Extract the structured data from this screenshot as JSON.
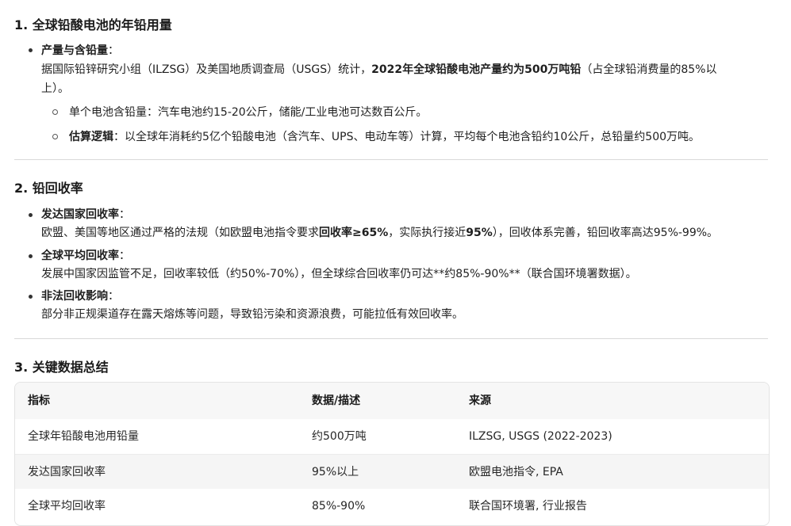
{
  "section1": {
    "heading": "1. 全球铅酸电池的年铅用量",
    "bullet1": {
      "label": "产量与含铅量",
      "colon": "：",
      "text_line1_pre": "据国际铅锌研究小组（ILZSG）及美国地质调查局（USGS）统计，",
      "text_line1_bold": "2022年全球铅酸电池产量约为500万吨铅",
      "text_line1_post": "（占全球铅消费量的85%以",
      "text_line2": "上）。",
      "sub1": "单个电池含铅量：汽车电池约15-20公斤，储能/工业电池可达数百公斤。",
      "sub2_label": "估算逻辑",
      "sub2_text": "：以全球年消耗约5亿个铅酸电池（含汽车、UPS、电动车等）计算，平均每个电池含铅约10公斤，总铅量约500万吨。"
    }
  },
  "section2": {
    "heading": "2. 铅回收率",
    "bullet1": {
      "label": "发达国家回收率",
      "colon": "：",
      "text_pre": "欧盟、美国等地区通过严格的法规（如欧盟电池指令要求",
      "text_bold1": "回收率≥65%",
      "text_mid": "，实际执行接近",
      "text_bold2": "95%",
      "text_post": "），回收体系完善，铅回收率高达95%-99%。"
    },
    "bullet2": {
      "label": "全球平均回收率",
      "colon": "：",
      "text": "发展中国家因监管不足，回收率较低（约50%-70%），但全球综合回收率仍可达**约85%-90%**（联合国环境署数据）。"
    },
    "bullet3": {
      "label": "非法回收影响",
      "colon": "：",
      "text": "部分非正规渠道存在露天熔炼等问题，导致铅污染和资源浪费，可能拉低有效回收率。"
    }
  },
  "section3": {
    "heading": "3. 关键数据总结",
    "table": {
      "headers": [
        "指标",
        "数据/描述",
        "来源"
      ],
      "rows": [
        [
          "全球年铅酸电池用铅量",
          "约500万吨",
          "ILZSG, USGS (2022-2023)"
        ],
        [
          "发达国家回收率",
          "95%以上",
          "欧盟电池指令, EPA"
        ],
        [
          "全球平均回收率",
          "85%-90%",
          "联合国环境署, 行业报告"
        ]
      ]
    }
  }
}
